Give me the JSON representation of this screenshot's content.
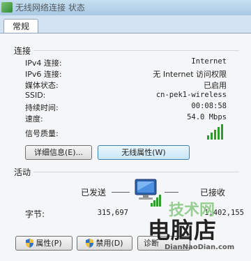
{
  "window": {
    "title": "无线网络连接 状态"
  },
  "tabs": [
    {
      "label": "常规"
    }
  ],
  "connection": {
    "section_title": "连接",
    "rows": [
      {
        "label": "IPv4 连接:",
        "value": "Internet"
      },
      {
        "label": "IPv6 连接:",
        "value": "无 Internet 访问权限"
      },
      {
        "label": "媒体状态:",
        "value": "已启用"
      },
      {
        "label": "SSID:",
        "value": "cn-pek1-wireless"
      },
      {
        "label": "持续时间:",
        "value": "00:08:58"
      },
      {
        "label": "速度:",
        "value": "54.0 Mbps"
      }
    ],
    "signal_label": "信号质量:",
    "signal_bars": 5,
    "details_button": "详细信息(E)...",
    "wireless_props_button": "无线属性(W)"
  },
  "activity": {
    "section_title": "活动",
    "sent_label": "已发送",
    "received_label": "已接收",
    "bytes_label": "字节:",
    "bytes_sent": "315,697",
    "bytes_received": "1,402,155"
  },
  "buttons": {
    "properties": "属性(P)",
    "disable": "禁用(D)",
    "diagnose": "诊断"
  },
  "watermark": {
    "top_text": "技术网",
    "main_text": "电脑店",
    "url": "DianNaoDian.com"
  },
  "colors": {
    "signal": "#2e9b2e",
    "shield_blue": "#2f6fd0",
    "shield_yellow": "#f2c431"
  }
}
